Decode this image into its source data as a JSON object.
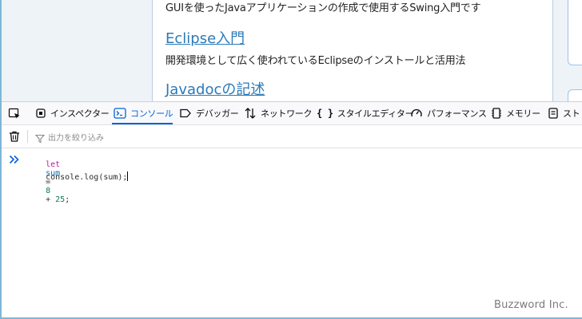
{
  "webpage": {
    "intro_text": "GUIを使ったJavaアプリケーションの作成で使用するSwing入門です",
    "link1": "Eclipse入門",
    "desc1": "開発環境として広く使われているEclipseのインストールと活用法",
    "link2": "Javadocの記述"
  },
  "devtools": {
    "tabs": [
      {
        "label": "インスペクター",
        "icon": "inspector-icon"
      },
      {
        "label": "コンソール",
        "icon": "console-icon"
      },
      {
        "label": "デバッガー",
        "icon": "debugger-icon"
      },
      {
        "label": "ネットワーク",
        "icon": "network-icon"
      },
      {
        "label": "スタイルエディター",
        "icon": "style-editor-icon"
      },
      {
        "label": "パフォーマンス",
        "icon": "performance-icon"
      },
      {
        "label": "メモリー",
        "icon": "memory-icon"
      },
      {
        "label": "スト",
        "icon": "storage-icon"
      }
    ],
    "active_tab": "コンソール",
    "filter_placeholder": "出力を絞り込み",
    "code": {
      "line1": {
        "kw": "let",
        "var": "sum",
        "eq": "=",
        "n1": "8",
        "plus": "+",
        "n2": "25",
        "end": ";"
      },
      "line2": "console.log(sum);"
    },
    "colors": {
      "accent": "#0060df",
      "keyword": "#b31b9c",
      "variable": "#0f6bb5"
    }
  },
  "watermark": "Buzzword Inc."
}
